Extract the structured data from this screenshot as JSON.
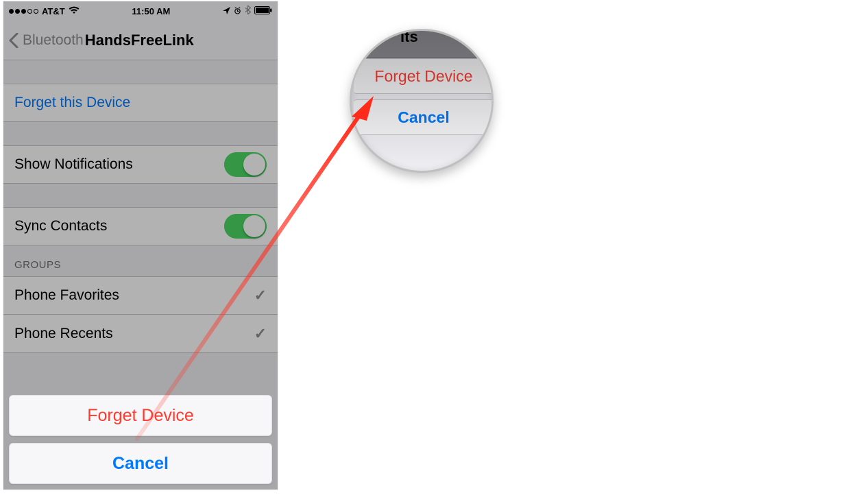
{
  "status": {
    "carrier": "AT&T",
    "time": "11:50 AM"
  },
  "nav": {
    "back": "Bluetooth",
    "title": "HandsFreeLink"
  },
  "rows": {
    "forget_this_device": "Forget this Device",
    "show_notifications": "Show Notifications",
    "sync_contacts": "Sync Contacts",
    "groups_header": "GROUPS",
    "phone_favorites": "Phone Favorites",
    "phone_recents": "Phone Recents"
  },
  "action_sheet": {
    "forget": "Forget Device",
    "cancel": "Cancel"
  },
  "magnifier": {
    "header_fragment": "its",
    "forget": "Forget Device",
    "cancel": "Cancel"
  }
}
